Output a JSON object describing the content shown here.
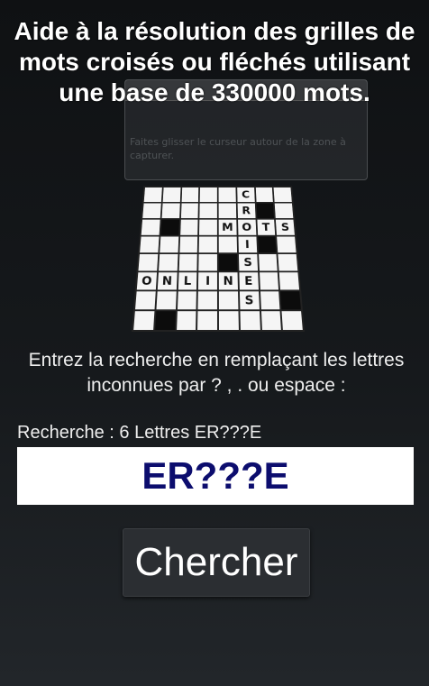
{
  "app": {
    "title": "Aide à la résolution des grilles de mots croisés ou fléchés utilisant une base de 330000 mots."
  },
  "background_ghost": {
    "text": "Faites glisser le curseur autour de la zone à capturer."
  },
  "crossword": {
    "rows": [
      [
        "",
        "",
        "",
        "",
        "",
        "C",
        "",
        ""
      ],
      [
        "",
        "",
        "",
        "",
        "",
        "R",
        "#",
        ""
      ],
      [
        "",
        "#",
        "",
        "",
        "M",
        "O",
        "T",
        "S"
      ],
      [
        "",
        "",
        "",
        "",
        "",
        "I",
        "#",
        ""
      ],
      [
        "",
        "",
        "",
        "",
        "#",
        "S",
        "",
        ""
      ],
      [
        "O",
        "N",
        "L",
        "I",
        "N",
        "E",
        "",
        ""
      ],
      [
        "",
        "",
        "",
        "",
        "",
        "S",
        "",
        "#"
      ],
      [
        "",
        "#",
        "",
        "",
        "",
        "",
        "",
        ""
      ]
    ]
  },
  "instruction": "Entrez la recherche en remplaçant les lettres inconnues par ? , . ou espace :",
  "search": {
    "label": "Recherche : 6 Lettres ER???E",
    "value": "ER???E"
  },
  "button": {
    "label": "Chercher"
  },
  "colors": {
    "input_text": "#0c0d6e",
    "button_bg": "#2b2e32"
  }
}
